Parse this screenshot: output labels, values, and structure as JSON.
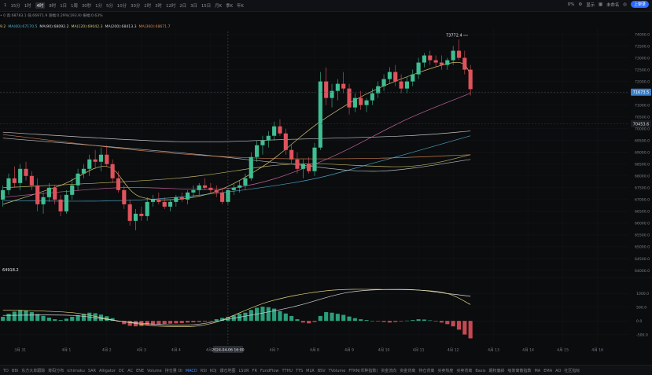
{
  "toolbar": {
    "intervals": [
      "1",
      "15分",
      "1时",
      "4时",
      "8时",
      "1日",
      "1周",
      "30秒",
      "1分",
      "5分",
      "10分",
      "30分",
      "2时",
      "3时",
      "12时",
      "2日",
      "3日",
      "15日",
      "月K",
      "季K",
      "年K"
    ],
    "active_index": 3,
    "right_items": [
      "0%",
      "显示",
      "未命名",
      "上架录"
    ]
  },
  "info_line": "• 0 高:68783.1 低:66971.9 涨幅:0.29%(193.9) 振幅:0.63%",
  "ma_lines": [
    {
      "text": "9.2",
      "color": "#d7ca6b"
    },
    {
      "text": "MA(60):67170.5",
      "color": "#4fb0d0"
    },
    {
      "text": "MA(90):68092.2",
      "color": "#d7d9de"
    },
    {
      "text": "MA(120):69042.3",
      "color": "#cfc76a"
    },
    {
      "text": "MA(200):68413.3",
      "color": "#d2d4d9"
    },
    {
      "text": "MA(360):68671.7",
      "color": "#d88a58"
    }
  ],
  "chart_data": [
    {
      "type": "candlestick",
      "price_axis": {
        "ticks": [
          74000.0,
          73500.0,
          73000.0,
          72500.0,
          72000.0,
          71500.0,
          71000.0,
          70500.0,
          70000.0,
          69500.0,
          69000.0,
          68500.0,
          68000.0,
          67500.0,
          67000.0,
          66500.0,
          66000.0,
          65500.0,
          65000.0,
          64500.0,
          64000.0
        ],
        "labels": [
          "74000.0",
          "73500.0",
          "73000.0",
          "72500.0",
          "72000.0",
          "71500.0",
          "71000.0",
          "70500.0",
          "70000.0",
          "69500.0",
          "69000.0",
          "68500.0",
          "68000.0",
          "67500.0",
          "67000.0",
          "66500.0",
          "66000.0",
          "65500.0",
          "65000.0",
          "64500.0",
          "64000.0"
        ],
        "ylim": [
          63800,
          74250
        ]
      },
      "current_price": "71673.5",
      "marker_price": "70453.6",
      "high_annotation": "73772.4",
      "low_annotation": "64918.2",
      "candles": [
        {
          "o": 67000,
          "h": 67600,
          "l": 66700,
          "c": 67400
        },
        {
          "o": 67400,
          "h": 68100,
          "l": 67200,
          "c": 67900
        },
        {
          "o": 67900,
          "h": 68400,
          "l": 67500,
          "c": 67700
        },
        {
          "o": 67700,
          "h": 68500,
          "l": 67400,
          "c": 68300
        },
        {
          "o": 68300,
          "h": 68600,
          "l": 67800,
          "c": 68000
        },
        {
          "o": 68000,
          "h": 68200,
          "l": 67400,
          "c": 67600
        },
        {
          "o": 67600,
          "h": 67900,
          "l": 66500,
          "c": 66800
        },
        {
          "o": 66800,
          "h": 67300,
          "l": 66400,
          "c": 67100
        },
        {
          "o": 67100,
          "h": 67700,
          "l": 66900,
          "c": 67500
        },
        {
          "o": 67500,
          "h": 67600,
          "l": 66800,
          "c": 67000
        },
        {
          "o": 67000,
          "h": 67200,
          "l": 66300,
          "c": 66500
        },
        {
          "o": 66500,
          "h": 67400,
          "l": 66400,
          "c": 67200
        },
        {
          "o": 67200,
          "h": 67900,
          "l": 67000,
          "c": 67600
        },
        {
          "o": 67600,
          "h": 68300,
          "l": 67400,
          "c": 68100
        },
        {
          "o": 68100,
          "h": 68500,
          "l": 67900,
          "c": 68300
        },
        {
          "o": 68300,
          "h": 68900,
          "l": 68000,
          "c": 68700
        },
        {
          "o": 68700,
          "h": 69100,
          "l": 68300,
          "c": 68600
        },
        {
          "o": 68600,
          "h": 69200,
          "l": 68200,
          "c": 68900
        },
        {
          "o": 68900,
          "h": 69300,
          "l": 68400,
          "c": 68500
        },
        {
          "o": 68500,
          "h": 68700,
          "l": 67700,
          "c": 67900
        },
        {
          "o": 67900,
          "h": 68200,
          "l": 67300,
          "c": 67400
        },
        {
          "o": 67400,
          "h": 67600,
          "l": 66600,
          "c": 66800
        },
        {
          "o": 66800,
          "h": 67000,
          "l": 65900,
          "c": 66100
        },
        {
          "o": 66100,
          "h": 66600,
          "l": 65700,
          "c": 66400
        },
        {
          "o": 66400,
          "h": 66700,
          "l": 66100,
          "c": 66300
        },
        {
          "o": 66300,
          "h": 67100,
          "l": 66100,
          "c": 66900
        },
        {
          "o": 66900,
          "h": 67200,
          "l": 66700,
          "c": 67000
        },
        {
          "o": 67000,
          "h": 67300,
          "l": 66800,
          "c": 66900
        },
        {
          "o": 66900,
          "h": 67100,
          "l": 66600,
          "c": 66700
        },
        {
          "o": 66700,
          "h": 67000,
          "l": 66500,
          "c": 66900
        },
        {
          "o": 66900,
          "h": 67200,
          "l": 66700,
          "c": 67100
        },
        {
          "o": 67100,
          "h": 67300,
          "l": 66900,
          "c": 67000
        },
        {
          "o": 67000,
          "h": 67400,
          "l": 66800,
          "c": 67300
        },
        {
          "o": 67300,
          "h": 67600,
          "l": 67100,
          "c": 67400
        },
        {
          "o": 67400,
          "h": 67700,
          "l": 67200,
          "c": 67600
        },
        {
          "o": 67600,
          "h": 67900,
          "l": 67400,
          "c": 67500
        },
        {
          "o": 67500,
          "h": 67700,
          "l": 67300,
          "c": 67400
        },
        {
          "o": 67400,
          "h": 67600,
          "l": 67100,
          "c": 67300
        },
        {
          "o": 67300,
          "h": 67500,
          "l": 66800,
          "c": 66900
        },
        {
          "o": 66900,
          "h": 67500,
          "l": 66800,
          "c": 67400
        },
        {
          "o": 67400,
          "h": 67700,
          "l": 67200,
          "c": 67500
        },
        {
          "o": 67500,
          "h": 67800,
          "l": 67300,
          "c": 67600
        },
        {
          "o": 67600,
          "h": 68100,
          "l": 67400,
          "c": 67900
        },
        {
          "o": 67900,
          "h": 69000,
          "l": 67800,
          "c": 68800
        },
        {
          "o": 68800,
          "h": 69500,
          "l": 68600,
          "c": 69300
        },
        {
          "o": 69300,
          "h": 69700,
          "l": 68900,
          "c": 69500
        },
        {
          "o": 69500,
          "h": 69900,
          "l": 69200,
          "c": 69700
        },
        {
          "o": 69700,
          "h": 70300,
          "l": 69500,
          "c": 70100
        },
        {
          "o": 70100,
          "h": 70400,
          "l": 69700,
          "c": 69800
        },
        {
          "o": 69800,
          "h": 70000,
          "l": 68900,
          "c": 69100
        },
        {
          "o": 69100,
          "h": 69300,
          "l": 68500,
          "c": 68700
        },
        {
          "o": 68700,
          "h": 69000,
          "l": 68100,
          "c": 68300
        },
        {
          "o": 68300,
          "h": 68700,
          "l": 67900,
          "c": 68500
        },
        {
          "o": 68500,
          "h": 68800,
          "l": 68100,
          "c": 68200
        },
        {
          "o": 68200,
          "h": 69400,
          "l": 68000,
          "c": 69200
        },
        {
          "o": 69200,
          "h": 72400,
          "l": 69100,
          "c": 72000
        },
        {
          "o": 72000,
          "h": 72600,
          "l": 71000,
          "c": 71300
        },
        {
          "o": 71300,
          "h": 71900,
          "l": 70900,
          "c": 71600
        },
        {
          "o": 71600,
          "h": 72100,
          "l": 71200,
          "c": 71900
        },
        {
          "o": 71900,
          "h": 72400,
          "l": 71500,
          "c": 71700
        },
        {
          "o": 71700,
          "h": 71900,
          "l": 70600,
          "c": 70900
        },
        {
          "o": 70900,
          "h": 71500,
          "l": 70700,
          "c": 71300
        },
        {
          "o": 71300,
          "h": 71600,
          "l": 70800,
          "c": 71000
        },
        {
          "o": 71000,
          "h": 71300,
          "l": 70700,
          "c": 71200
        },
        {
          "o": 71200,
          "h": 71700,
          "l": 71000,
          "c": 71500
        },
        {
          "o": 71500,
          "h": 72000,
          "l": 71300,
          "c": 71800
        },
        {
          "o": 71800,
          "h": 72300,
          "l": 71600,
          "c": 72100
        },
        {
          "o": 72100,
          "h": 72600,
          "l": 71900,
          "c": 72400
        },
        {
          "o": 72400,
          "h": 72700,
          "l": 71800,
          "c": 72000
        },
        {
          "o": 72000,
          "h": 72300,
          "l": 71500,
          "c": 71700
        },
        {
          "o": 71700,
          "h": 72200,
          "l": 71500,
          "c": 72000
        },
        {
          "o": 72000,
          "h": 72500,
          "l": 71800,
          "c": 72300
        },
        {
          "o": 72300,
          "h": 73000,
          "l": 72100,
          "c": 72800
        },
        {
          "o": 72800,
          "h": 73200,
          "l": 72600,
          "c": 73100
        },
        {
          "o": 73100,
          "h": 73300,
          "l": 72700,
          "c": 72900
        },
        {
          "o": 72900,
          "h": 73100,
          "l": 72600,
          "c": 72800
        },
        {
          "o": 72800,
          "h": 73100,
          "l": 72500,
          "c": 72700
        },
        {
          "o": 72700,
          "h": 73000,
          "l": 72500,
          "c": 72900
        },
        {
          "o": 72900,
          "h": 73500,
          "l": 72700,
          "c": 73300
        },
        {
          "o": 73300,
          "h": 73772,
          "l": 72900,
          "c": 73000
        },
        {
          "o": 73000,
          "h": 73300,
          "l": 72300,
          "c": 72500
        },
        {
          "o": 72500,
          "h": 72700,
          "l": 71400,
          "c": 71674
        }
      ],
      "ma_lines": [
        {
          "name": "MA(60)",
          "color": "#4fb0d0",
          "values": [
            {
              "i": 0,
              "v": 66950
            },
            {
              "i": 25,
              "v": 67000
            },
            {
              "i": 50,
              "v": 67700
            },
            {
              "i": 65,
              "v": 68600
            },
            {
              "i": 81,
              "v": 69700
            }
          ]
        },
        {
          "name": "MA(90)",
          "color": "#c9cbd1",
          "values": [
            {
              "i": 0,
              "v": 69600
            },
            {
              "i": 30,
              "v": 69000
            },
            {
              "i": 50,
              "v": 68500
            },
            {
              "i": 65,
              "v": 68200
            },
            {
              "i": 81,
              "v": 68700
            }
          ]
        },
        {
          "name": "MA(120)",
          "color": "#cfc76a",
          "values": [
            {
              "i": 0,
              "v": 67500
            },
            {
              "i": 30,
              "v": 67900
            },
            {
              "i": 50,
              "v": 68500
            },
            {
              "i": 70,
              "v": 68400
            },
            {
              "i": 81,
              "v": 68900
            }
          ]
        },
        {
          "name": "MA(200)",
          "color": "#d7d9de",
          "values": [
            {
              "i": 0,
              "v": 69850
            },
            {
              "i": 30,
              "v": 69450
            },
            {
              "i": 50,
              "v": 69550
            },
            {
              "i": 70,
              "v": 69700
            },
            {
              "i": 81,
              "v": 69900
            }
          ]
        },
        {
          "name": "MA(360)",
          "color": "#d88a58",
          "values": [
            {
              "i": 0,
              "v": 69750
            },
            {
              "i": 25,
              "v": 69050
            },
            {
              "i": 45,
              "v": 68750
            },
            {
              "i": 65,
              "v": 68750
            },
            {
              "i": 81,
              "v": 68900
            }
          ]
        },
        {
          "name": "short-ma-yellow",
          "color": "#e5d57a",
          "values": [
            {
              "i": 0,
              "v": 66800
            },
            {
              "i": 10,
              "v": 67600
            },
            {
              "i": 18,
              "v": 68400
            },
            {
              "i": 24,
              "v": 67100
            },
            {
              "i": 35,
              "v": 67200
            },
            {
              "i": 45,
              "v": 68400
            },
            {
              "i": 55,
              "v": 70300
            },
            {
              "i": 65,
              "v": 71700
            },
            {
              "i": 78,
              "v": 72800
            },
            {
              "i": 81,
              "v": 72300
            }
          ]
        },
        {
          "name": "short-ma-pink",
          "color": "#d36ca8",
          "values": [
            {
              "i": 0,
              "v": 67100
            },
            {
              "i": 20,
              "v": 67500
            },
            {
              "i": 40,
              "v": 67500
            },
            {
              "i": 55,
              "v": 68600
            },
            {
              "i": 70,
              "v": 70400
            },
            {
              "i": 81,
              "v": 71500
            }
          ]
        }
      ],
      "x_ticks": [
        {
          "i": 3,
          "label": "3月 31"
        },
        {
          "i": 11,
          "label": "4月 1"
        },
        {
          "i": 18,
          "label": "4月 2"
        },
        {
          "i": 24,
          "label": "4月 3"
        },
        {
          "i": 30,
          "label": "4月 4"
        },
        {
          "i": 36,
          "label": "4月 5"
        },
        {
          "i": 47,
          "label": "4月 7"
        },
        {
          "i": 54,
          "label": "4月 8"
        },
        {
          "i": 60,
          "label": "4月 9"
        },
        {
          "i": 66,
          "label": "4月 10"
        },
        {
          "i": 72,
          "label": "4月 11"
        },
        {
          "i": 78,
          "label": "4月 12"
        },
        {
          "i": 85,
          "label": "4月 13"
        },
        {
          "i": 91,
          "label": "4月 14"
        },
        {
          "i": 97,
          "label": "4月 15"
        },
        {
          "i": 103,
          "label": "4月 16"
        }
      ],
      "crosshair_label": "2024-04-06 16:00",
      "crosshair_i": 39,
      "total_slots": 109
    },
    {
      "type": "bar",
      "indicator": "MACD",
      "axis_ticks": [
        1000.0,
        500.0,
        0.0,
        -500.0
      ],
      "axis_labels": [
        "1000.0",
        "500.0",
        "0.0",
        "-500.0"
      ],
      "ylim": [
        -800,
        1500
      ],
      "values": [
        150,
        260,
        340,
        400,
        380,
        320,
        250,
        180,
        120,
        60,
        30,
        80,
        150,
        210,
        260,
        300,
        280,
        230,
        170,
        100,
        -30,
        -120,
        -180,
        -200,
        -190,
        -160,
        -140,
        -130,
        -110,
        -100,
        -90,
        -80,
        -60,
        -50,
        -40,
        -30,
        -20,
        60,
        110,
        150,
        200,
        260,
        300,
        400,
        480,
        520,
        500,
        450,
        360,
        270,
        180,
        60,
        -60,
        -90,
        -40,
        180,
        320,
        300,
        260,
        220,
        160,
        100,
        60,
        30,
        0,
        -20,
        -40,
        -60,
        -40,
        -20,
        10,
        30,
        60,
        50,
        20,
        -20,
        -60,
        -120,
        -200,
        -320,
        -500,
        -640
      ],
      "line1": [
        {
          "i": 0,
          "v": 400
        },
        {
          "i": 12,
          "v": 300
        },
        {
          "i": 20,
          "v": 0
        },
        {
          "i": 28,
          "v": -200
        },
        {
          "i": 36,
          "v": -100
        },
        {
          "i": 46,
          "v": 700
        },
        {
          "i": 56,
          "v": 1100
        },
        {
          "i": 66,
          "v": 1150
        },
        {
          "i": 76,
          "v": 1050
        },
        {
          "i": 81,
          "v": 600
        }
      ],
      "line2": [
        {
          "i": 0,
          "v": 200
        },
        {
          "i": 12,
          "v": 200
        },
        {
          "i": 22,
          "v": -50
        },
        {
          "i": 32,
          "v": -150
        },
        {
          "i": 40,
          "v": 100
        },
        {
          "i": 50,
          "v": 500
        },
        {
          "i": 60,
          "v": 1050
        },
        {
          "i": 70,
          "v": 1150
        },
        {
          "i": 77,
          "v": 1000
        },
        {
          "i": 81,
          "v": 900
        }
      ]
    }
  ],
  "bottom_tabs": [
    "TD",
    "BBI",
    "东方大单跟踪",
    "筹码分布",
    "ichimoku",
    "SAR",
    "Alligator",
    "DC",
    "AC",
    "ENE",
    "Volume",
    "持仓量 OI",
    "MACD",
    "RSI",
    "KDJ",
    "爆仓地图",
    "LSUR",
    "FR",
    "FundFlow",
    "TTHU",
    "TTS",
    "MLR",
    "BSV",
    "TVolume",
    "FTRN(币种指数)",
    "资金流向",
    "资金背离",
    "持仓背离",
    "买卖热度",
    "买卖背离",
    "Basis",
    "期权偏斜",
    "吸筹离散指数",
    "MA",
    "EMA",
    "AO",
    "社区指标"
  ],
  "bottom_active_index": 12
}
